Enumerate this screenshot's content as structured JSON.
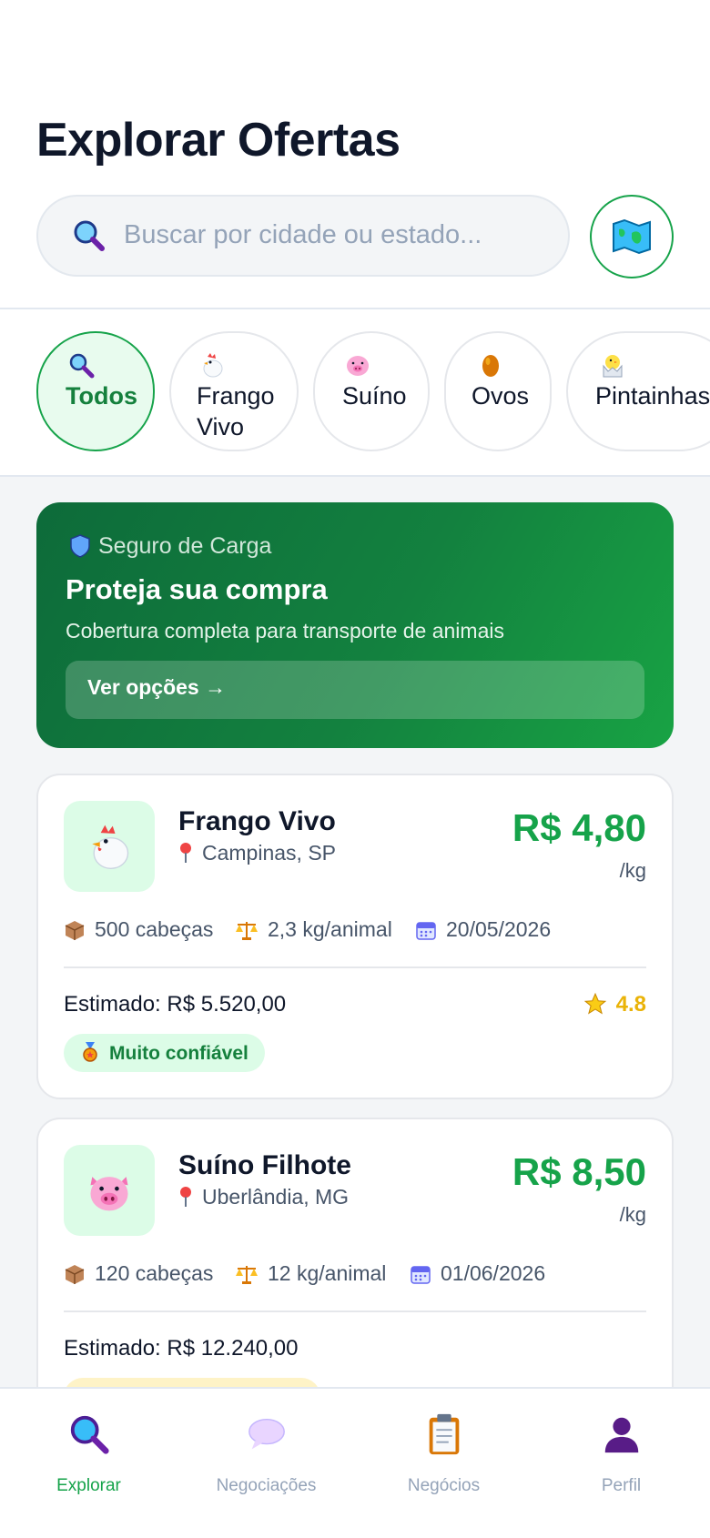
{
  "header": {
    "title": "Explorar Ofertas"
  },
  "search": {
    "placeholder": "Buscar por cidade ou estado..."
  },
  "categories": [
    {
      "label": "Todos",
      "icon": "search-icon",
      "active": true
    },
    {
      "label": "Frango\nVivo",
      "icon": "chicken-icon"
    },
    {
      "label": "Suíno",
      "icon": "pig-icon"
    },
    {
      "label": "Ovos",
      "icon": "egg-icon"
    },
    {
      "label": "Pintainhas",
      "icon": "chick-icon"
    }
  ],
  "banner": {
    "tag": "Seguro de Carga",
    "title": "Proteja sua compra",
    "subtitle": "Cobertura completa para transporte de animais",
    "cta": "Ver opções →"
  },
  "listings": [
    {
      "name": "Frango Vivo",
      "location": "Campinas, SP",
      "price": "R$ 4,80",
      "unit": "/kg",
      "quantity": "500 cabeças",
      "weight": "2,3 kg/animal",
      "date": "20/05/2026",
      "estimate": "Estimado: R$ 5.520,00",
      "rating": "4.8",
      "badge": "Muito confiável"
    },
    {
      "name": "Suíno Filhote",
      "location": "Uberlândia, MG",
      "price": "R$ 8,50",
      "unit": "/kg",
      "quantity": "120 cabeças",
      "weight": "12 kg/animal",
      "date": "01/06/2026",
      "estimate": "Estimado: R$ 12.240,00"
    }
  ],
  "nav": [
    {
      "label": "Explorar",
      "icon": "search-icon",
      "active": true
    },
    {
      "label": "Negociações",
      "icon": "chat-bubble-icon"
    },
    {
      "label": "Negócios",
      "icon": "clipboard-icon"
    },
    {
      "label": "Perfil",
      "icon": "user-icon"
    }
  ],
  "colors": {
    "accent": "#16a34a",
    "banner_dark": "#0d6b3a",
    "banner_light": "#18a344"
  }
}
